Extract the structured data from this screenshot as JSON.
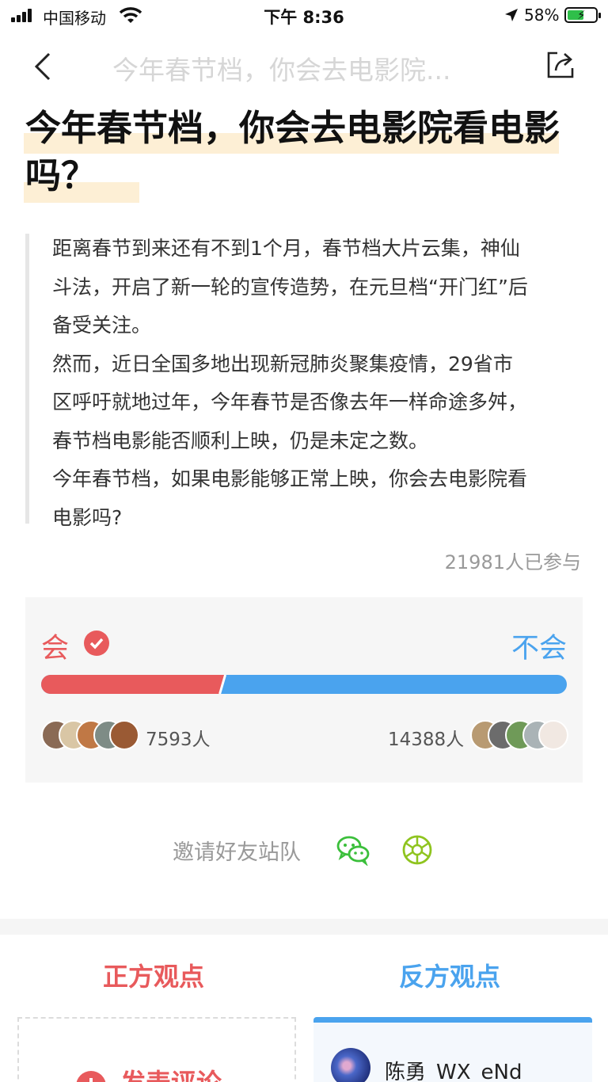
{
  "status_bar": {
    "carrier": "中国移动",
    "time": "下午 8:36",
    "battery": "58%"
  },
  "nav": {
    "title": "今年春节档，你会去电影院..."
  },
  "headline": "今年春节档，你会去电影院看电影吗？",
  "description": [
    "距离春节到来还有不到1个月，春节档大片云集，神仙\n斗法，开启了新一轮的宣传造势，在元旦档“开门红”后\n备受关注。",
    "然而，近日全国多地出现新冠肺炎聚集疫情，29省市\n区呼吁就地过年，今年春节是否像去年一样命途多舛，\n春节档电影能否顺利上映，仍是未定之数。",
    "今年春节档，如果电影能够正常上映，你会去电影院看\n电影吗?"
  ],
  "participants": "21981人已参与",
  "vote": {
    "yes_label": "会",
    "no_label": "不会",
    "yes_count": "7593人",
    "no_count": "14388人",
    "yes_share": 0.345,
    "yes_color": "#e85a5c",
    "no_color": "#4aa3ee"
  },
  "invite": {
    "text": "邀请好友站队",
    "wechat_icon": "wechat-icon",
    "moments_icon": "moments-icon"
  },
  "tabs": {
    "pro": "正方观点",
    "con": "反方观点"
  },
  "comment": {
    "label": "发表评论"
  },
  "con_card": {
    "user": "陈勇_WX_eNd"
  }
}
